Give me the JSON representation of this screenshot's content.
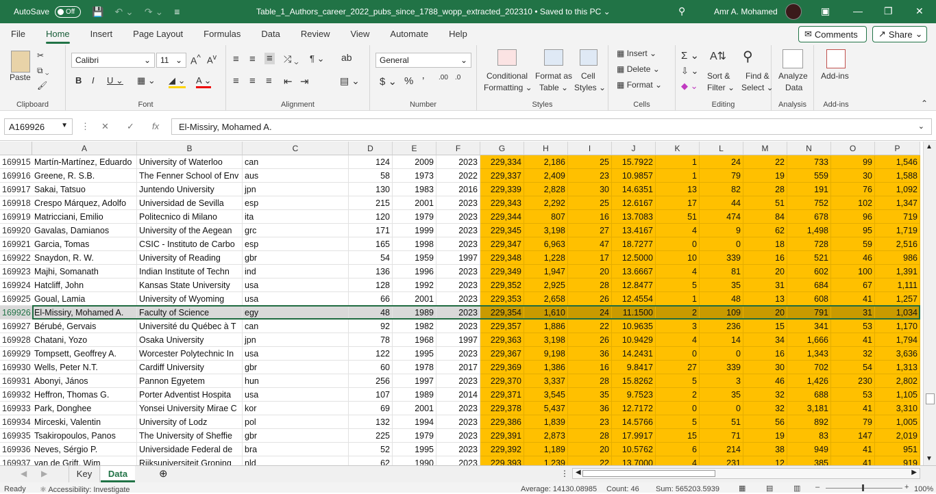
{
  "titlebar": {
    "autosave_label": "AutoSave",
    "autosave_state": "Off",
    "document_title": "Table_1_Authors_career_2022_pubs_since_1788_wopp_extracted_202310 • Saved to this PC ⌄",
    "user_name": "Amr A. Mohamed"
  },
  "menu": {
    "items": [
      "File",
      "Home",
      "Insert",
      "Page Layout",
      "Formulas",
      "Data",
      "Review",
      "View",
      "Automate",
      "Help"
    ],
    "comments_label": "Comments",
    "share_label": "Share"
  },
  "ribbon": {
    "clipboard": {
      "paste": "Paste",
      "group": "Clipboard"
    },
    "font": {
      "name": "Calibri",
      "size": "11",
      "group": "Font"
    },
    "alignment": {
      "group": "Alignment"
    },
    "number": {
      "format": "General",
      "group": "Number"
    },
    "styles": {
      "conditional_1": "Conditional",
      "conditional_2": "Formatting ⌄",
      "format_as_1": "Format as",
      "format_as_2": "Table ⌄",
      "cell_1": "Cell",
      "cell_2": "Styles ⌄",
      "group": "Styles"
    },
    "cells": {
      "insert": "Insert ⌄",
      "delete": "Delete ⌄",
      "format": "Format ⌄",
      "group": "Cells"
    },
    "editing": {
      "sort_1": "Sort &",
      "sort_2": "Filter ⌄",
      "find_1": "Find &",
      "find_2": "Select ⌄",
      "group": "Editing"
    },
    "analysis": {
      "analyze_1": "Analyze",
      "analyze_2": "Data",
      "group": "Analysis"
    },
    "addins": {
      "label": "Add-ins",
      "group": "Add-ins"
    }
  },
  "formula_bar": {
    "name_box": "A169926",
    "fx": "fx",
    "content": "El-Missiry, Mohamed A."
  },
  "columns": [
    "A",
    "B",
    "C",
    "D",
    "E",
    "F",
    "G",
    "H",
    "I",
    "J",
    "K",
    "L",
    "M",
    "N",
    "O",
    "P"
  ],
  "rows": [
    {
      "n": "169915",
      "c": [
        "Martín-Martínez, Eduardo",
        "University of Waterloo",
        "can",
        "124",
        "2009",
        "2023",
        "229,334",
        "2,186",
        "25",
        "15.7922",
        "1",
        "24",
        "22",
        "733",
        "99",
        "1,546"
      ]
    },
    {
      "n": "169916",
      "c": [
        "Greene, R. S.B.",
        "The Fenner School of Env",
        "aus",
        "58",
        "1973",
        "2022",
        "229,337",
        "2,409",
        "23",
        "10.9857",
        "1",
        "79",
        "19",
        "559",
        "30",
        "1,588"
      ]
    },
    {
      "n": "169917",
      "c": [
        "Sakai, Tatsuo",
        "Juntendo University",
        "jpn",
        "130",
        "1983",
        "2016",
        "229,339",
        "2,828",
        "30",
        "14.6351",
        "13",
        "82",
        "28",
        "191",
        "76",
        "1,092"
      ]
    },
    {
      "n": "169918",
      "c": [
        "Crespo Márquez, Adolfo",
        "Universidad de Sevilla",
        "esp",
        "215",
        "2001",
        "2023",
        "229,343",
        "2,292",
        "25",
        "12.6167",
        "17",
        "44",
        "51",
        "752",
        "102",
        "1,347"
      ]
    },
    {
      "n": "169919",
      "c": [
        "Matricciani, Emilio",
        "Politecnico di Milano",
        "ita",
        "120",
        "1979",
        "2023",
        "229,344",
        "807",
        "16",
        "13.7083",
        "51",
        "474",
        "84",
        "678",
        "96",
        "719"
      ]
    },
    {
      "n": "169920",
      "c": [
        "Gavalas, Damianos",
        "University of the Aegean",
        "grc",
        "171",
        "1999",
        "2023",
        "229,345",
        "3,198",
        "27",
        "13.4167",
        "4",
        "9",
        "62",
        "1,498",
        "95",
        "1,719"
      ]
    },
    {
      "n": "169921",
      "c": [
        "Garcia, Tomas",
        "CSIC - Instituto de Carbo",
        "esp",
        "165",
        "1998",
        "2023",
        "229,347",
        "6,963",
        "47",
        "18.7277",
        "0",
        "0",
        "18",
        "728",
        "59",
        "2,516"
      ]
    },
    {
      "n": "169922",
      "c": [
        "Snaydon, R. W.",
        "University of Reading",
        "gbr",
        "54",
        "1959",
        "1997",
        "229,348",
        "1,228",
        "17",
        "12.5000",
        "10",
        "339",
        "16",
        "521",
        "46",
        "986"
      ]
    },
    {
      "n": "169923",
      "c": [
        "Majhi, Somanath",
        "Indian Institute of Techn",
        "ind",
        "136",
        "1996",
        "2023",
        "229,349",
        "1,947",
        "20",
        "13.6667",
        "4",
        "81",
        "20",
        "602",
        "100",
        "1,391"
      ]
    },
    {
      "n": "169924",
      "c": [
        "Hatcliff, John",
        "Kansas State University",
        "usa",
        "128",
        "1992",
        "2023",
        "229,352",
        "2,925",
        "28",
        "12.8477",
        "5",
        "35",
        "31",
        "684",
        "67",
        "1,111"
      ]
    },
    {
      "n": "169925",
      "c": [
        "Goual, Lamia",
        "University of Wyoming",
        "usa",
        "66",
        "2001",
        "2023",
        "229,353",
        "2,658",
        "26",
        "12.4554",
        "1",
        "48",
        "13",
        "608",
        "41",
        "1,257"
      ]
    },
    {
      "n": "169926",
      "c": [
        "El-Missiry, Mohamed A.",
        "Faculty of Science",
        "egy",
        "48",
        "1989",
        "2023",
        "229,354",
        "1,610",
        "24",
        "11.1500",
        "2",
        "109",
        "20",
        "791",
        "31",
        "1,034"
      ]
    },
    {
      "n": "169927",
      "c": [
        "Bérubé, Gervais",
        "Université du Québec à T",
        "can",
        "92",
        "1982",
        "2023",
        "229,357",
        "1,886",
        "22",
        "10.9635",
        "3",
        "236",
        "15",
        "341",
        "53",
        "1,170"
      ]
    },
    {
      "n": "169928",
      "c": [
        "Chatani, Yozo",
        "Osaka University",
        "jpn",
        "78",
        "1968",
        "1997",
        "229,363",
        "3,198",
        "26",
        "10.9429",
        "4",
        "14",
        "34",
        "1,666",
        "41",
        "1,794"
      ]
    },
    {
      "n": "169929",
      "c": [
        "Tompsett, Geoffrey A.",
        "Worcester Polytechnic In",
        "usa",
        "122",
        "1995",
        "2023",
        "229,367",
        "9,198",
        "36",
        "14.2431",
        "0",
        "0",
        "16",
        "1,343",
        "32",
        "3,636"
      ]
    },
    {
      "n": "169930",
      "c": [
        "Wells, Peter N.T.",
        "Cardiff University",
        "gbr",
        "60",
        "1978",
        "2017",
        "229,369",
        "1,386",
        "16",
        "9.8417",
        "27",
        "339",
        "30",
        "702",
        "54",
        "1,313"
      ]
    },
    {
      "n": "169931",
      "c": [
        "Abonyi, János",
        "Pannon Egyetem",
        "hun",
        "256",
        "1997",
        "2023",
        "229,370",
        "3,337",
        "28",
        "15.8262",
        "5",
        "3",
        "46",
        "1,426",
        "230",
        "2,802"
      ]
    },
    {
      "n": "169932",
      "c": [
        "Heffron, Thomas G.",
        "Porter Adventist Hospita",
        "usa",
        "107",
        "1989",
        "2014",
        "229,371",
        "3,545",
        "35",
        "9.7523",
        "2",
        "35",
        "32",
        "688",
        "53",
        "1,105"
      ]
    },
    {
      "n": "169933",
      "c": [
        "Park, Donghee",
        "Yonsei University Mirae C",
        "kor",
        "69",
        "2001",
        "2023",
        "229,378",
        "5,437",
        "36",
        "12.7172",
        "0",
        "0",
        "32",
        "3,181",
        "41",
        "3,310"
      ]
    },
    {
      "n": "169934",
      "c": [
        "Mirceski, Valentin",
        "University of Lodz",
        "pol",
        "132",
        "1994",
        "2023",
        "229,386",
        "1,839",
        "23",
        "14.5766",
        "5",
        "51",
        "56",
        "892",
        "79",
        "1,005"
      ]
    },
    {
      "n": "169935",
      "c": [
        "Tsakiropoulos, Panos",
        "The University of Sheffie",
        "gbr",
        "225",
        "1979",
        "2023",
        "229,391",
        "2,873",
        "28",
        "17.9917",
        "15",
        "71",
        "19",
        "83",
        "147",
        "2,019"
      ]
    },
    {
      "n": "169936",
      "c": [
        "Neves, Sérgio P.",
        "Universidade Federal de",
        "bra",
        "52",
        "1995",
        "2023",
        "229,392",
        "1,189",
        "20",
        "10.5762",
        "6",
        "214",
        "38",
        "949",
        "41",
        "951"
      ]
    },
    {
      "n": "169937",
      "c": [
        "van de Grift, Wim",
        "Rijksuniversiteit Groning",
        "nld",
        "62",
        "1990",
        "2023",
        "229,393",
        "1,239",
        "22",
        "13.7000",
        "4",
        "231",
        "12",
        "385",
        "41",
        "919"
      ]
    }
  ],
  "selected_row": "169926",
  "sheets": [
    "Key",
    "Data"
  ],
  "active_sheet": "Data",
  "status": {
    "ready": "Ready",
    "accessibility": "Accessibility: Investigate",
    "average": "Average: 14130.08985",
    "count": "Count: 46",
    "sum": "Sum: 565203.5939",
    "zoom": "100%"
  },
  "colors": {
    "accent": "#217346",
    "highlight": "#ffc000"
  }
}
